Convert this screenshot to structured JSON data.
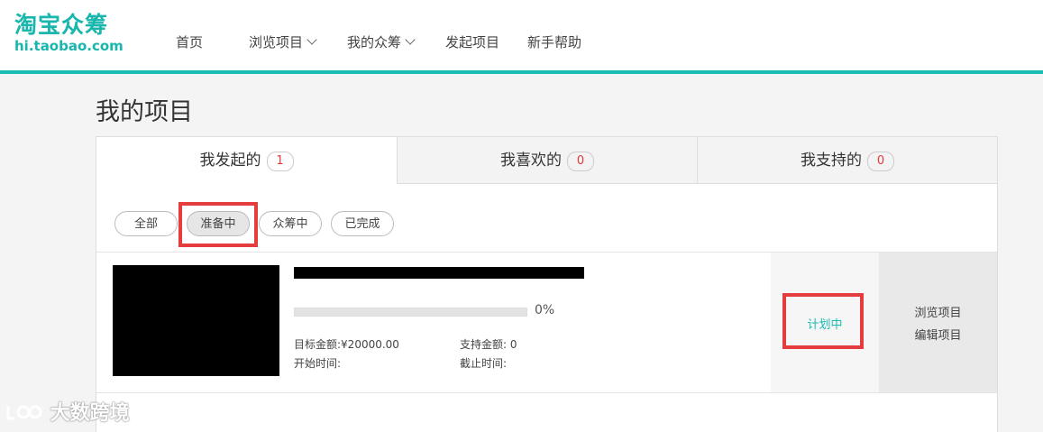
{
  "brand": {
    "name_cn": "淘宝众筹",
    "domain": "hi.taobao.com",
    "accent": "#1bbcb6"
  },
  "nav": {
    "items": [
      {
        "label": "首页"
      },
      {
        "label": "浏览项目",
        "dropdown": true
      },
      {
        "label": "我的众筹",
        "dropdown": true
      },
      {
        "label": "发起项目"
      },
      {
        "label": "新手帮助"
      }
    ]
  },
  "page": {
    "title": "我的项目"
  },
  "tabs": [
    {
      "label": "我发起的",
      "count": "1",
      "selected": true
    },
    {
      "label": "我喜欢的",
      "count": "0"
    },
    {
      "label": "我支持的",
      "count": "0"
    }
  ],
  "filters": [
    {
      "label": "全部"
    },
    {
      "label": "准备中",
      "selected": true
    },
    {
      "label": "众筹中"
    },
    {
      "label": "已完成"
    }
  ],
  "project": {
    "progress_percent": 0,
    "progress_text": "0%",
    "goal_label": "目标金额:",
    "goal_value": "¥20000.00",
    "support_label": "支持金额:",
    "support_value": "0",
    "start_label": "开始时间:",
    "start_value": "",
    "end_label": "截止时间:",
    "end_value": "",
    "status": "计划中",
    "actions": [
      "浏览项目",
      "编辑项目"
    ]
  },
  "watermark": {
    "text": "大数跨境"
  }
}
